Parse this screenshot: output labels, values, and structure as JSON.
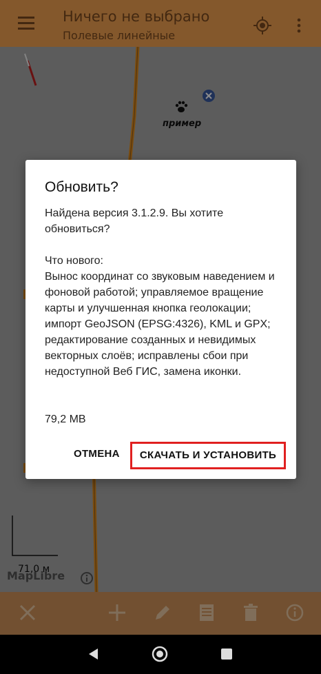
{
  "toolbar": {
    "title": "Ничего не выбрано",
    "subtitle": "Полевые линейные",
    "menu_icon": "hamburger-icon",
    "locate_icon": "crosshair-icon",
    "more_icon": "more-vert-icon"
  },
  "map": {
    "poi_label": "пример",
    "scale_label": "71,0 м",
    "attribution": "MapLibre"
  },
  "dialog": {
    "title": "Обновить?",
    "message": "Найдена версия 3.1.2.9. Вы хотите обновиться?\n\nЧто нового:\nВынос координат со звуковым наведением и фоновой работой; управляемое вращение карты и улучшенная кнопка геолокации; импорт GeoJSON (EPSG:4326), KML и GPX; редактирование созданных и невидимых векторных слоёв; исправлены сбои при недоступной Веб ГИС, замена иконки.",
    "size": "79,2 MB",
    "cancel_label": "ОТМЕНА",
    "install_label": "СКАЧАТЬ И УСТАНОВИТЬ"
  },
  "colors": {
    "toolbar": "#f0a050",
    "highlight": "#e02020",
    "map_line": "#e08a1a"
  }
}
